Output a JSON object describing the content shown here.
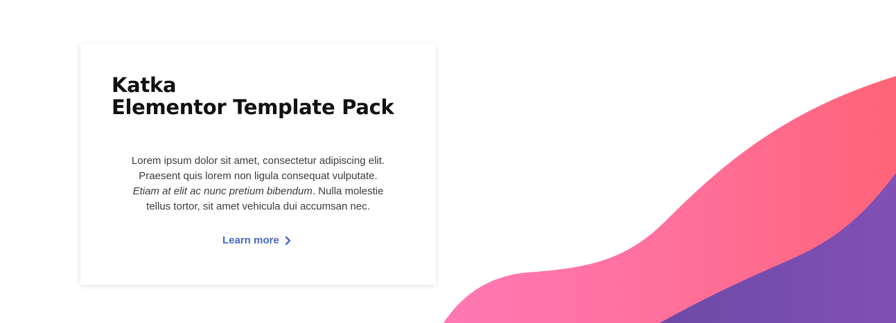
{
  "card": {
    "title_line1": "Katka",
    "title_line2": "Elementor Template Pack",
    "body_line1": "Lorem ipsum dolor sit amet, consectetur adipiscing elit.",
    "body_line2": "Praesent quis lorem non ligula consequat vulputate.",
    "body_line3_italic": "Etiam at elit ac nunc pretium bibendum",
    "body_line3_rest": ". Nulla molestie",
    "body_line4": "tellus tortor, sit amet vehicula dui accumsan nec.",
    "cta_label": "Learn more",
    "cta_icon": "chevron-right-icon"
  },
  "colors": {
    "pink_wave_start": "#ff78b4",
    "pink_wave_end": "#ff6478",
    "purple_wave": "#7d4fb0",
    "link": "#4a67c3"
  }
}
